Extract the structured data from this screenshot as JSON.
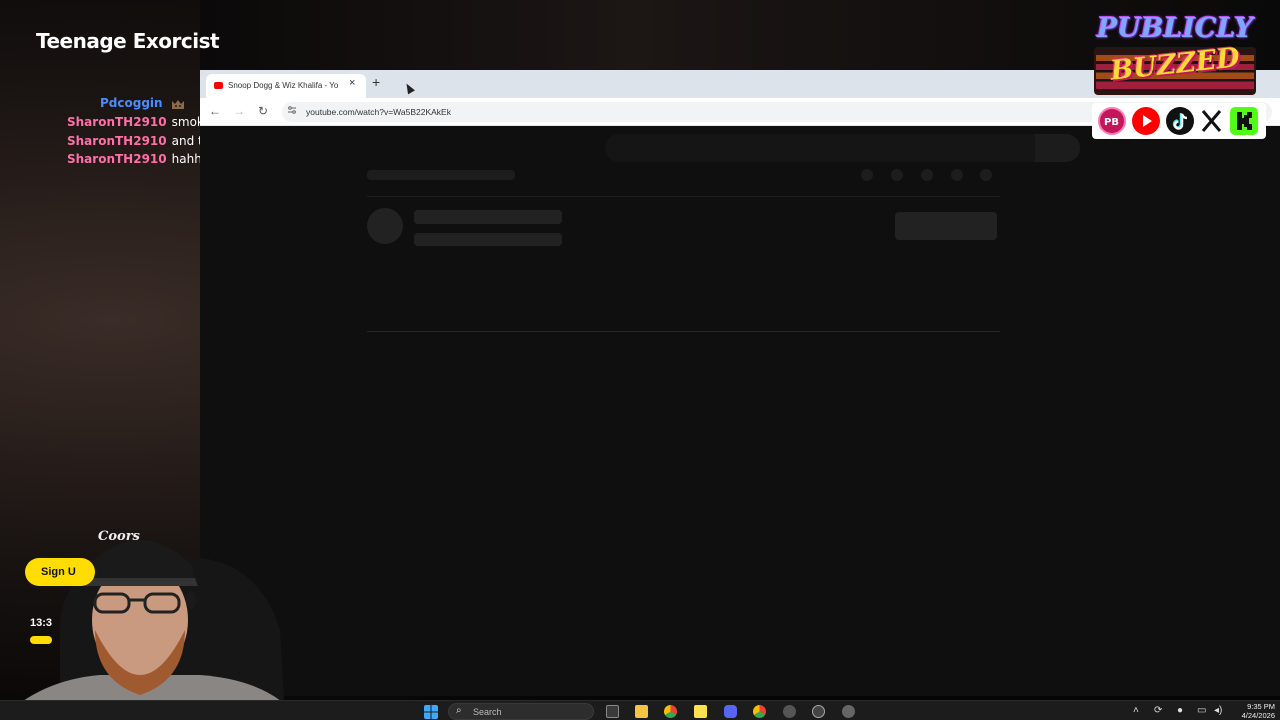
{
  "stream": {
    "title": "Teenage Exorcist"
  },
  "chat": {
    "messages": [
      {
        "user": "Pdcoggin",
        "text": "",
        "user_color": "#4a8cff"
      },
      {
        "user": "SharonTH2910",
        "text": "smoke weed",
        "user_color": "#ff6fa8"
      },
      {
        "user": "SharonTH2910",
        "text": "and then get high",
        "user_color": "#ff6fa8"
      },
      {
        "user": "SharonTH2910",
        "text": "hahh",
        "user_color": "#ff6fa8"
      }
    ]
  },
  "browser": {
    "tab_title": "Snoop Dogg & Wiz Khalifa - Yo",
    "tab_favicon": "youtube-icon",
    "new_tab_symbol": "+",
    "close_symbol": "×",
    "url": "youtube.com/watch?v=Wa5B22KAkEk",
    "nav": {
      "back": "←",
      "forward": "→",
      "reload": "↻"
    }
  },
  "logo": {
    "line1": "PUBLICLY",
    "line2": "BUZZED"
  },
  "socials": [
    "publicly-buzzed-icon",
    "youtube-icon",
    "tiktok-icon",
    "x-icon",
    "kick-icon"
  ],
  "overlay": {
    "signup_label": "Sign U",
    "clock_partial": "13:3"
  },
  "taskbar": {
    "search_placeholder": "Search",
    "time": "9:35 PM",
    "date": "4/24/2026"
  },
  "colors": {
    "accent_yellow": "#ffdd00",
    "youtube_red": "#ff0000",
    "kick_green": "#53fc18"
  }
}
